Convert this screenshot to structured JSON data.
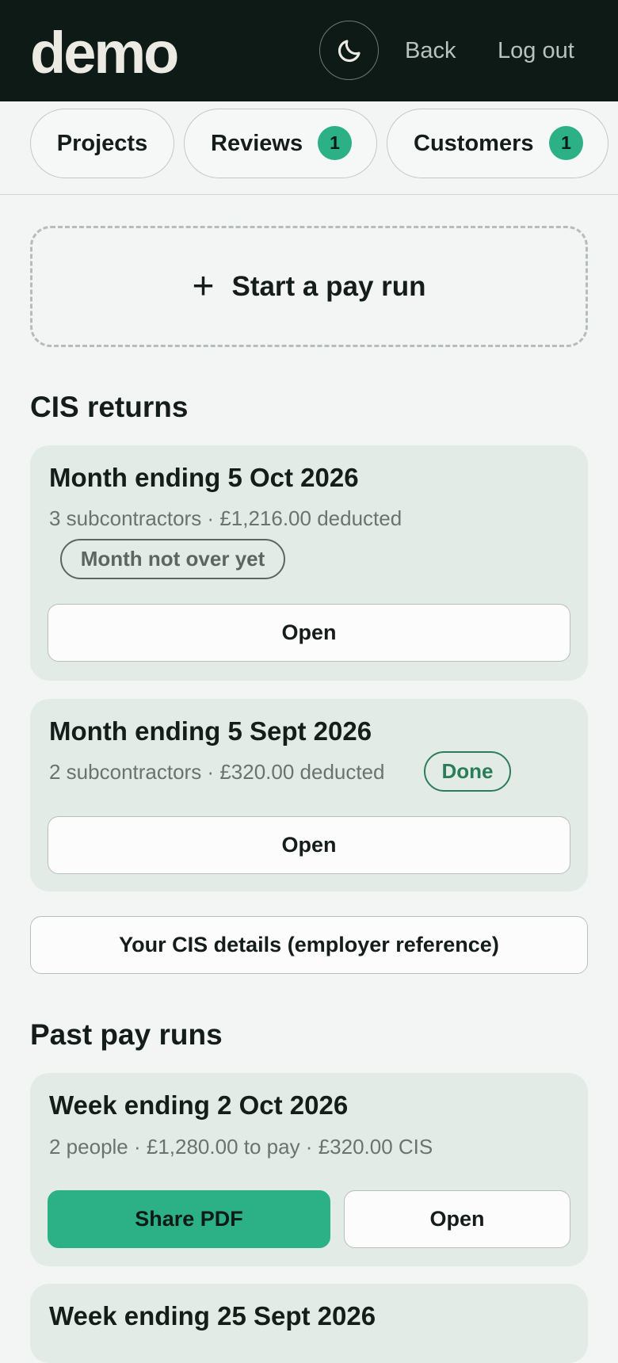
{
  "header": {
    "logo": "demo",
    "back_label": "Back",
    "logout_label": "Log out"
  },
  "tabs": [
    {
      "label": "Projects"
    },
    {
      "label": "Reviews",
      "badge": "1"
    },
    {
      "label": "Customers",
      "badge": "1"
    }
  ],
  "start_run": {
    "icon": "+",
    "label": "Start a pay run"
  },
  "cis": {
    "title": "CIS returns",
    "returns": [
      {
        "title": "Month ending 5 Oct 2026",
        "meta": "3 subcontractors · £1,216.00 deducted",
        "status": "Month not over yet",
        "open_label": "Open"
      },
      {
        "title": "Month ending 5 Sept 2026",
        "meta": "2 subcontractors · £320.00 deducted",
        "status": "Done",
        "open_label": "Open"
      }
    ],
    "details_label": "Your CIS details (employer reference)"
  },
  "past_runs": {
    "title": "Past pay runs",
    "runs": [
      {
        "title": "Week ending 2 Oct 2026",
        "meta": "2 people · £1,280.00 to pay · £320.00 CIS",
        "share_label": "Share PDF",
        "open_label": "Open"
      },
      {
        "title": "Week ending 25 Sept 2026"
      }
    ]
  },
  "colors": {
    "header_bg": "#0e1a16",
    "accent": "#2bb185",
    "done": "#2b7d59",
    "card_bg": "#e2ebe6",
    "page_bg": "#f2f5f3"
  },
  "icons": {
    "theme_toggle": "moon-icon",
    "start_run": "plus-icon"
  }
}
